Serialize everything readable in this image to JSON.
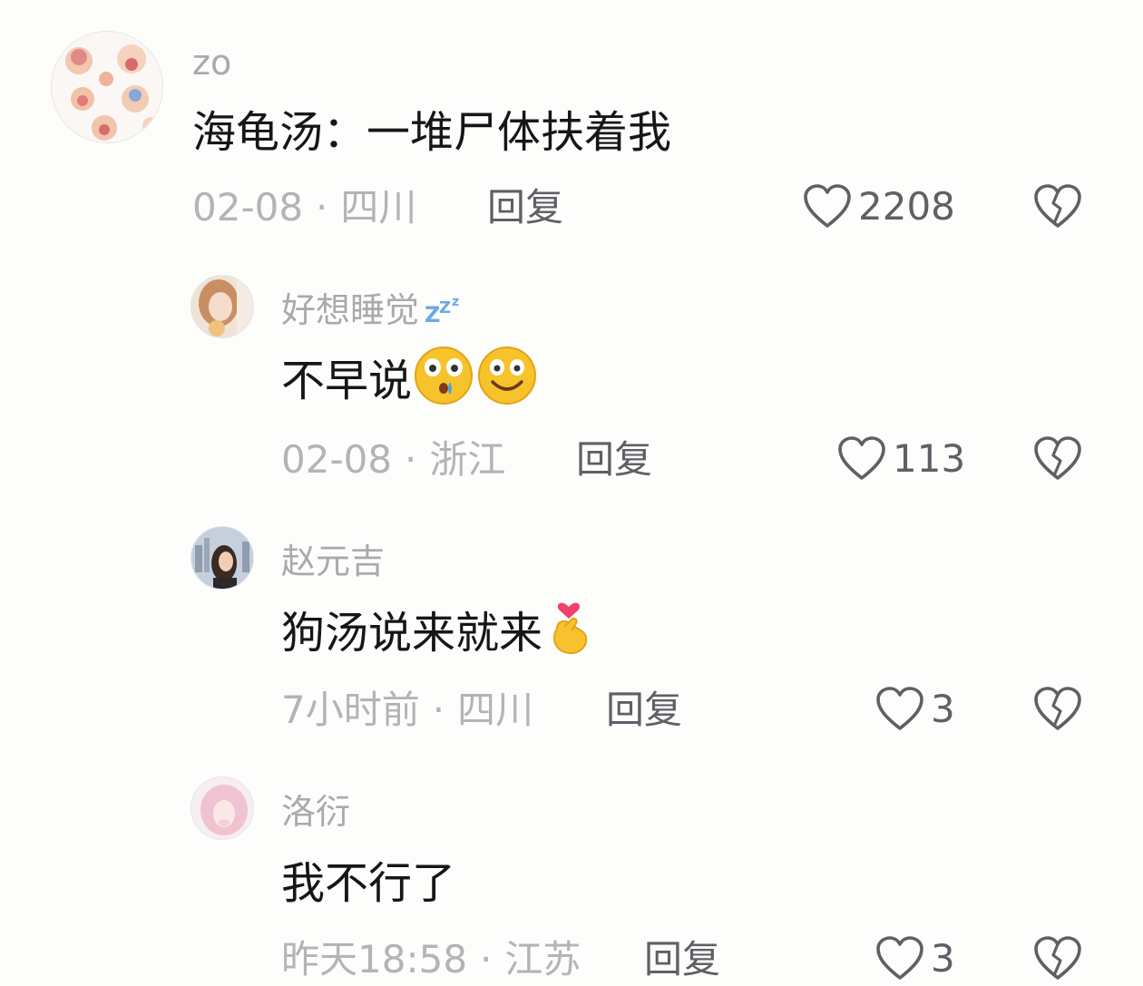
{
  "comments": [
    {
      "username": "zo",
      "text": "海龟汤：一堆尸体扶着我",
      "date": "02-08",
      "location": "四川",
      "reply_label": "回复",
      "likes": "2208",
      "avatar_icon": "sticker-collage-avatar"
    },
    {
      "username": "好想睡觉",
      "username_emoji": "zzz-icon",
      "text": "不早说",
      "text_emojis": [
        "surprised-face-icon",
        "smiling-face-icon"
      ],
      "date": "02-08",
      "location": "浙江",
      "reply_label": "回复",
      "likes": "113",
      "avatar_icon": "girl-photo-avatar"
    },
    {
      "username": "赵元吉",
      "text": "狗汤说来就来",
      "text_emojis": [
        "finger-heart-icon"
      ],
      "date": "7小时前",
      "location": "四川",
      "reply_label": "回复",
      "likes": "3",
      "avatar_icon": "city-girl-avatar"
    },
    {
      "username": "洛衍",
      "text": "我不行了",
      "date": "昨天18:58",
      "location": "江苏",
      "reply_label": "回复",
      "likes": "3",
      "avatar_icon": "pink-hair-avatar"
    }
  ],
  "meta_separator": "·",
  "colors": {
    "username": "#a9a9ae",
    "text": "#161616",
    "meta": "#b3b3b8",
    "action": "#5f5f66",
    "background": "#fdfdfb"
  }
}
